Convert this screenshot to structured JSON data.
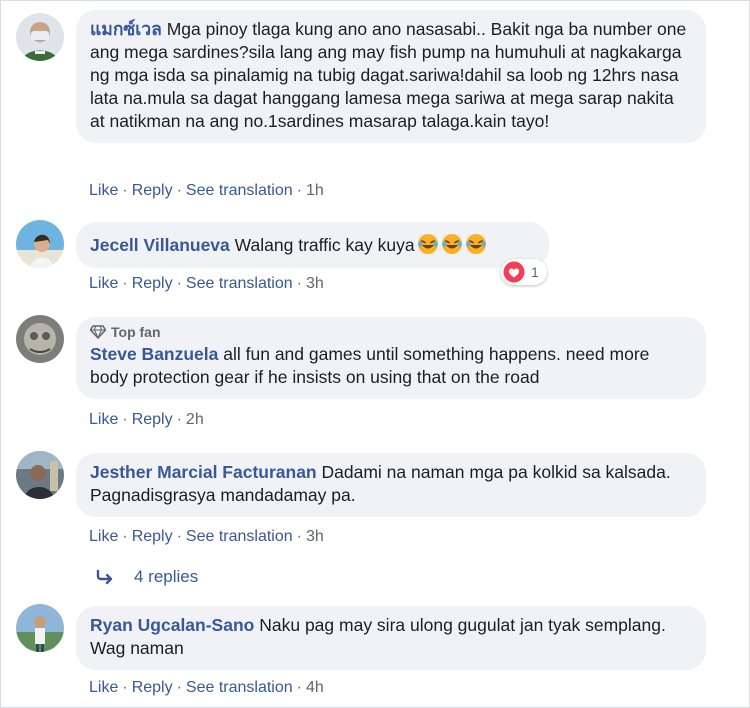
{
  "comments": [
    {
      "author": "แมกซ์เวล",
      "text": "Mga pinoy tlaga kung ano ano nasasabi.. Bakit nga ba number one ang mega sardines?sila lang ang may fish pump na humuhuli at nagkakarga ng mga isda sa pinalamig na tubig dagat.sariwa!dahil sa loob ng 12hrs nasa lata na.mula sa dagat hanggang lamesa mega sariwa at mega sarap nakita at natikman na ang no.1sardines masarap talaga.kain tayo!",
      "actions": {
        "like": "Like",
        "reply": "Reply",
        "translate": "See translation",
        "time": "1h"
      }
    },
    {
      "author": "Jecell Villanueva",
      "text": "Walang traffic kay kuya",
      "emojis": [
        "laughing-crying-emoji",
        "laughing-crying-emoji",
        "laughing-crying-emoji"
      ],
      "reaction": {
        "icon": "heart-reaction-icon",
        "count": "1"
      },
      "actions": {
        "like": "Like",
        "reply": "Reply",
        "translate": "See translation",
        "time": "3h"
      }
    },
    {
      "badge": "Top fan",
      "author": "Steve Banzuela",
      "text": "all fun and games until something happens. need more body protection gear if he insists on using that on the road",
      "actions": {
        "like": "Like",
        "reply": "Reply",
        "time": "2h"
      }
    },
    {
      "author": "Jesther Marcial Facturanan",
      "text": "Dadami na naman mga pa kolkid sa kalsada. Pagnadisgrasya mandadamay pa.",
      "actions": {
        "like": "Like",
        "reply": "Reply",
        "translate": "See translation",
        "time": "3h"
      },
      "replies_label": "4 replies"
    },
    {
      "author": "Ryan Ugcalan-Sano",
      "text": "Naku pag may sira ulong gugulat jan tyak semplang. Wag naman",
      "actions": {
        "like": "Like",
        "reply": "Reply",
        "translate": "See translation",
        "time": "4h"
      }
    }
  ],
  "separator": "·",
  "colors": {
    "link": "#385898",
    "bubble": "#f0f2f5",
    "meta": "#606770",
    "heart": "#f33e58",
    "emoji": "#f7b125"
  }
}
